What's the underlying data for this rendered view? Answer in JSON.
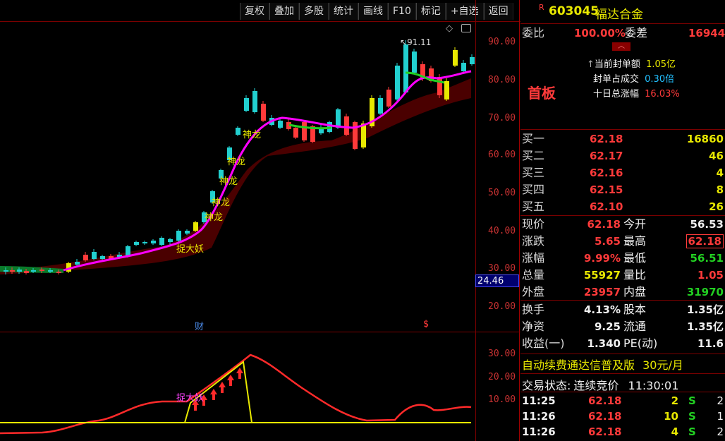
{
  "toolbar": {
    "buttons": [
      "复权",
      "叠加",
      "多股",
      "统计",
      "画线",
      "F10",
      "标记",
      "+自选",
      "返回"
    ]
  },
  "stock": {
    "badge": "R",
    "code": "603045",
    "name": "福达合金"
  },
  "main_chart": {
    "price_axis": [
      "90.00",
      "80.00",
      "70.00",
      "60.00",
      "50.00",
      "40.00",
      "30.00",
      "20.00"
    ],
    "current_price_tag": "24.46",
    "high_marker": "91.11",
    "annotations": [
      "神龙",
      "神龙",
      "神龙",
      "神龙",
      "神龙",
      "捉大妖"
    ],
    "bottom_markers": [
      "财",
      "$"
    ]
  },
  "sub_chart": {
    "axis": [
      "30.00",
      "20.00",
      "10.00"
    ],
    "label": "捉大妖"
  },
  "order": {
    "wei_bi_label": "委比",
    "wei_bi": "100.00%",
    "wei_cha_label": "委差",
    "wei_cha": "16944",
    "seal_label": "当前封单额",
    "seal_value": "1.05亿",
    "seal_ratio_label": "封单占成交",
    "seal_ratio": "0.30倍",
    "ten_day_label": "十日总涨幅",
    "ten_day": "16.03%",
    "board": "首板"
  },
  "bids": [
    {
      "label": "买一",
      "price": "62.18",
      "vol": "16860"
    },
    {
      "label": "买二",
      "price": "62.17",
      "vol": "46"
    },
    {
      "label": "买三",
      "price": "62.16",
      "vol": "4"
    },
    {
      "label": "买四",
      "price": "62.15",
      "vol": "8"
    },
    {
      "label": "买五",
      "price": "62.10",
      "vol": "26"
    }
  ],
  "quote": [
    {
      "l1": "现价",
      "v1": "62.18",
      "l2": "今开",
      "v2": "56.53"
    },
    {
      "l1": "涨跌",
      "v1": "5.65",
      "l2": "最高",
      "v2": "62.18"
    },
    {
      "l1": "涨幅",
      "v1": "9.99%",
      "l2": "最低",
      "v2": "56.51"
    },
    {
      "l1": "总量",
      "v1": "55927",
      "l2": "量比",
      "v2": "1.05"
    },
    {
      "l1": "外盘",
      "v1": "23957",
      "l2": "内盘",
      "v2": "31970"
    }
  ],
  "fund": [
    {
      "l1": "换手",
      "v1": "4.13%",
      "l2": "股本",
      "v2": "1.35亿"
    },
    {
      "l1": "净资",
      "v1": "9.25",
      "l2": "流通",
      "v2": "1.35亿"
    },
    {
      "l1": "收益(一)",
      "v1": "1.340",
      "l2": "PE(动)",
      "v2": "11.6"
    }
  ],
  "promo": {
    "text": "自动续费通达信普及版",
    "price": "30元/月"
  },
  "status": {
    "label": "交易状态:",
    "value": "连续竞价",
    "time": "11:30:01"
  },
  "ticks": [
    {
      "time": "11:25",
      "price": "62.18",
      "vol": "2",
      "side": "S",
      "n": "2"
    },
    {
      "time": "11:26",
      "price": "62.18",
      "vol": "10",
      "side": "S",
      "n": "1"
    },
    {
      "time": "11:26",
      "price": "62.18",
      "vol": "4",
      "side": "S",
      "n": "2"
    }
  ],
  "colors": {
    "up": "#ff3a3a",
    "down": "#22d0d0",
    "ma": "#ff00ff",
    "yellow": "#e8e800",
    "grid": "#7a0000"
  }
}
